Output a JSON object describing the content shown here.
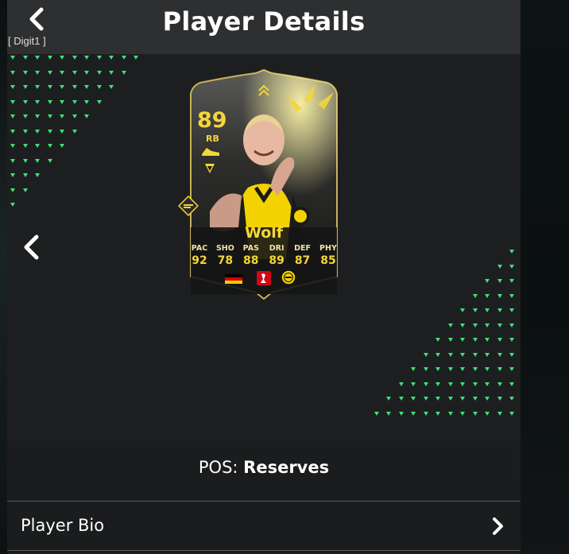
{
  "header": {
    "title": "Player Details",
    "hotkey_label": "[ Digit1 ]"
  },
  "card": {
    "rating": "89",
    "position": "RB",
    "name": "Wolf",
    "stats": [
      {
        "label": "PAC",
        "value": "92"
      },
      {
        "label": "SHO",
        "value": "78"
      },
      {
        "label": "PAS",
        "value": "88"
      },
      {
        "label": "DRI",
        "value": "89"
      },
      {
        "label": "DEF",
        "value": "87"
      },
      {
        "label": "PHY",
        "value": "85"
      }
    ],
    "nation_icon": "germany-flag-icon",
    "league_icon": "bundesliga-icon",
    "club_icon": "bvb-crest-icon",
    "accent_color": "#f4d63a"
  },
  "details": {
    "pos_label": "POS:",
    "pos_value": "Reserves",
    "bio_label": "Player Bio"
  },
  "colors": {
    "header_bg": "#2e2f30",
    "panel_bg": "#1b1c1d",
    "pattern_accent": "#3fe07a"
  }
}
